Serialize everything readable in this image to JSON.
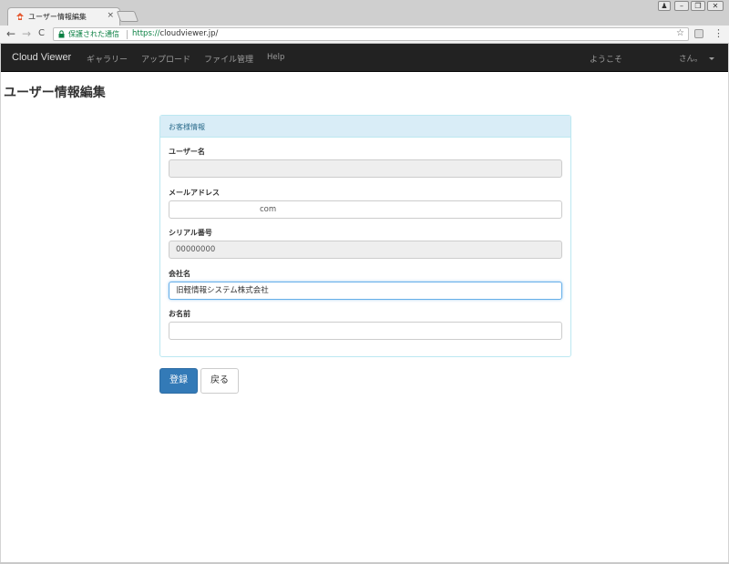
{
  "browser": {
    "tab_title": "ユーザー情報編集",
    "tab_close": "×",
    "window_buttons": [
      "♟",
      "–",
      "❐",
      "✕"
    ],
    "nav_icons": {
      "back": "←",
      "forward": "→",
      "reload": "C"
    },
    "secure_label": "保護された通信",
    "url_scheme": "https://",
    "url_rest": "cloudviewer.jp/",
    "bookmark_icon": "☆",
    "menu_icon": "⋮"
  },
  "navbar": {
    "brand": "Cloud Viewer",
    "links": [
      "ギャラリー",
      "アップロード",
      "ファイル管理",
      "Help"
    ],
    "welcome": "ようこそ",
    "user_suffix": "さん。"
  },
  "page": {
    "title": "ユーザー情報編集"
  },
  "panel": {
    "heading": "お客様情報",
    "fields": [
      {
        "label": "ユーザー名",
        "value": "",
        "readonly": true
      },
      {
        "label": "メールアドレス",
        "value": "com",
        "readonly": false
      },
      {
        "label": "シリアル番号",
        "value": "00000000",
        "readonly": true
      },
      {
        "label": "会社名",
        "value": "旧軽情報システム株式会社",
        "readonly": false,
        "focused": true
      },
      {
        "label": "お名前",
        "value": "",
        "readonly": false
      }
    ]
  },
  "buttons": {
    "submit": "登録",
    "back": "戻る"
  },
  "colors": {
    "navbar_bg": "#222222",
    "panel_heading_bg": "#d9edf7",
    "primary": "#337ab7"
  }
}
